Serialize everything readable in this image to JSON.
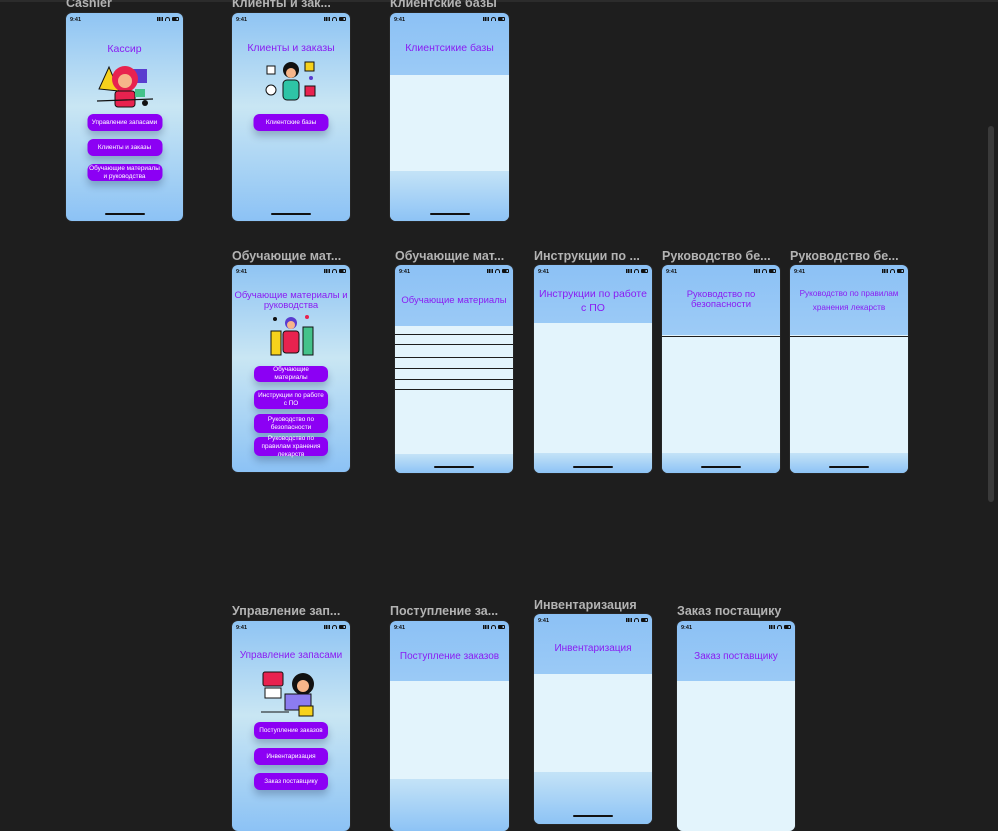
{
  "status_time": "9:41",
  "frames": {
    "cashier": {
      "label": "Cashier",
      "title": "Кассир",
      "buttons": [
        "Управление запасами",
        "Клиенты и заказы",
        "Обучающие материалы и руководства"
      ]
    },
    "clients": {
      "label": "Клиенты и зак...",
      "title": "Клиенты и заказы",
      "buttons": [
        "Клиентские базы"
      ]
    },
    "client_bases": {
      "label": "Клиентские базы",
      "title": "Клиентсикие базы"
    },
    "training": {
      "label": "Обучающие мат...",
      "title": "Обучающие материалы и руководства",
      "buttons": [
        "Обучающие материалы",
        "Инструкции по работе с ПО",
        "Руководство по безопасности",
        "Руководство по правилам хранения лекарств"
      ]
    },
    "training_materials": {
      "label": "Обучающие мат...",
      "title": "Обучающие материалы"
    },
    "instructions": {
      "label": "Инструкции по ...",
      "title": "Инструкции по работе с ПО"
    },
    "safety": {
      "label": "Руководство бе...",
      "title": "Руководство по безопасности"
    },
    "storage": {
      "label": "Руководство бе...",
      "title": "Руководство по правилам хранения лекарств"
    },
    "inventory_mgmt": {
      "label": "Управление зап...",
      "title": "Управление запасами",
      "buttons": [
        "Поступление заказов",
        "Инвентаризация",
        "Заказ поставщику"
      ]
    },
    "incoming_orders": {
      "label": "Поступление за...",
      "title": "Поступление заказов"
    },
    "stocktaking": {
      "label": "Инвентаризация",
      "title": "Инвентаризация"
    },
    "supplier_order": {
      "label": "Заказ постащику",
      "title": "Заказ поставщику"
    }
  },
  "colors": {
    "accent": "#8c00f4",
    "title": "#8a1cf2",
    "canvas": "#1e1e1e",
    "sheet": "#e3f4fc"
  }
}
